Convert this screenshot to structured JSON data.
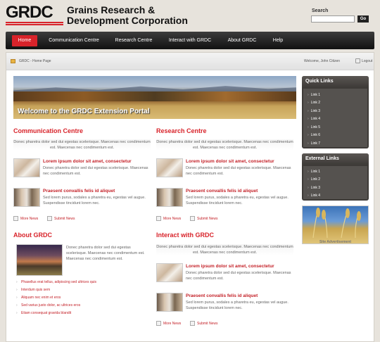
{
  "header": {
    "logo_text": "GRDC",
    "org_name_line1": "Grains Research &",
    "org_name_line2": "Development Corporation",
    "search_label": "Search",
    "search_value": "",
    "search_button": "Go"
  },
  "nav": {
    "items": [
      "Home",
      "Communication Centre",
      "Research Centre",
      "Interact with GRDC",
      "About GRDC",
      "Help"
    ],
    "active": "Home"
  },
  "breadcrumb": {
    "text": "GRDC - Home Page",
    "welcome": "Welcome, John Citizen",
    "logout": "Logout"
  },
  "banner": {
    "text": "Welcome to the GRDC Extension Portal"
  },
  "lorem_intro": "Donec pharetra dolor sed dui egestas scelerisque. Maecenas nec condimentum est. Maecenas nec condimentum est.",
  "news_a": {
    "title": "Lorem ipsum dolor sit amet, consectetur",
    "text": "Donec pharetra dolor sed dui egestas scelerisque. Maecenas nec condimentum est."
  },
  "news_b": {
    "title": "Praesent convallis felis id aliquet",
    "text": "Sed lorem purus, sodales a pharetra eu, egestas vel augue. Suspendisse tincidunt lorem nec."
  },
  "links": {
    "more_news": "More News",
    "submit_news": "Submit News"
  },
  "communication": {
    "title": "Communication Centre"
  },
  "research": {
    "title": "Research Centre"
  },
  "interact": {
    "title": "Interact with GRDC"
  },
  "about": {
    "title": "About GRDC",
    "text": "Donec pharetra dolor sed dui egestas scelerisque. Maecenas nec condimentum est. Maecenas nec condimentum est.",
    "list": [
      "Phasellus erat tellus, adipiscing sed ultrices quis",
      "Interdum quis sem",
      "Aliquam nec enim et eros",
      "Sed varius justo dolor, ac ultrices eros",
      "Etiam consequat gravida blandit"
    ]
  },
  "quick_links": {
    "title": "Quick Links",
    "items": [
      "Link 1",
      "Link 2",
      "Link 3",
      "Link 4",
      "Link 5",
      "Link 6",
      "Link 7"
    ]
  },
  "external_links": {
    "title": "External Links",
    "items": [
      "Link 1",
      "Link 2",
      "Link 3",
      "Link 4"
    ]
  },
  "advertisement": {
    "caption": "Site Advertisement"
  },
  "colors": {
    "accent": "#d8232a",
    "nav_bg": "#1a1a1a",
    "sidebar_bg": "#3e3b38"
  }
}
